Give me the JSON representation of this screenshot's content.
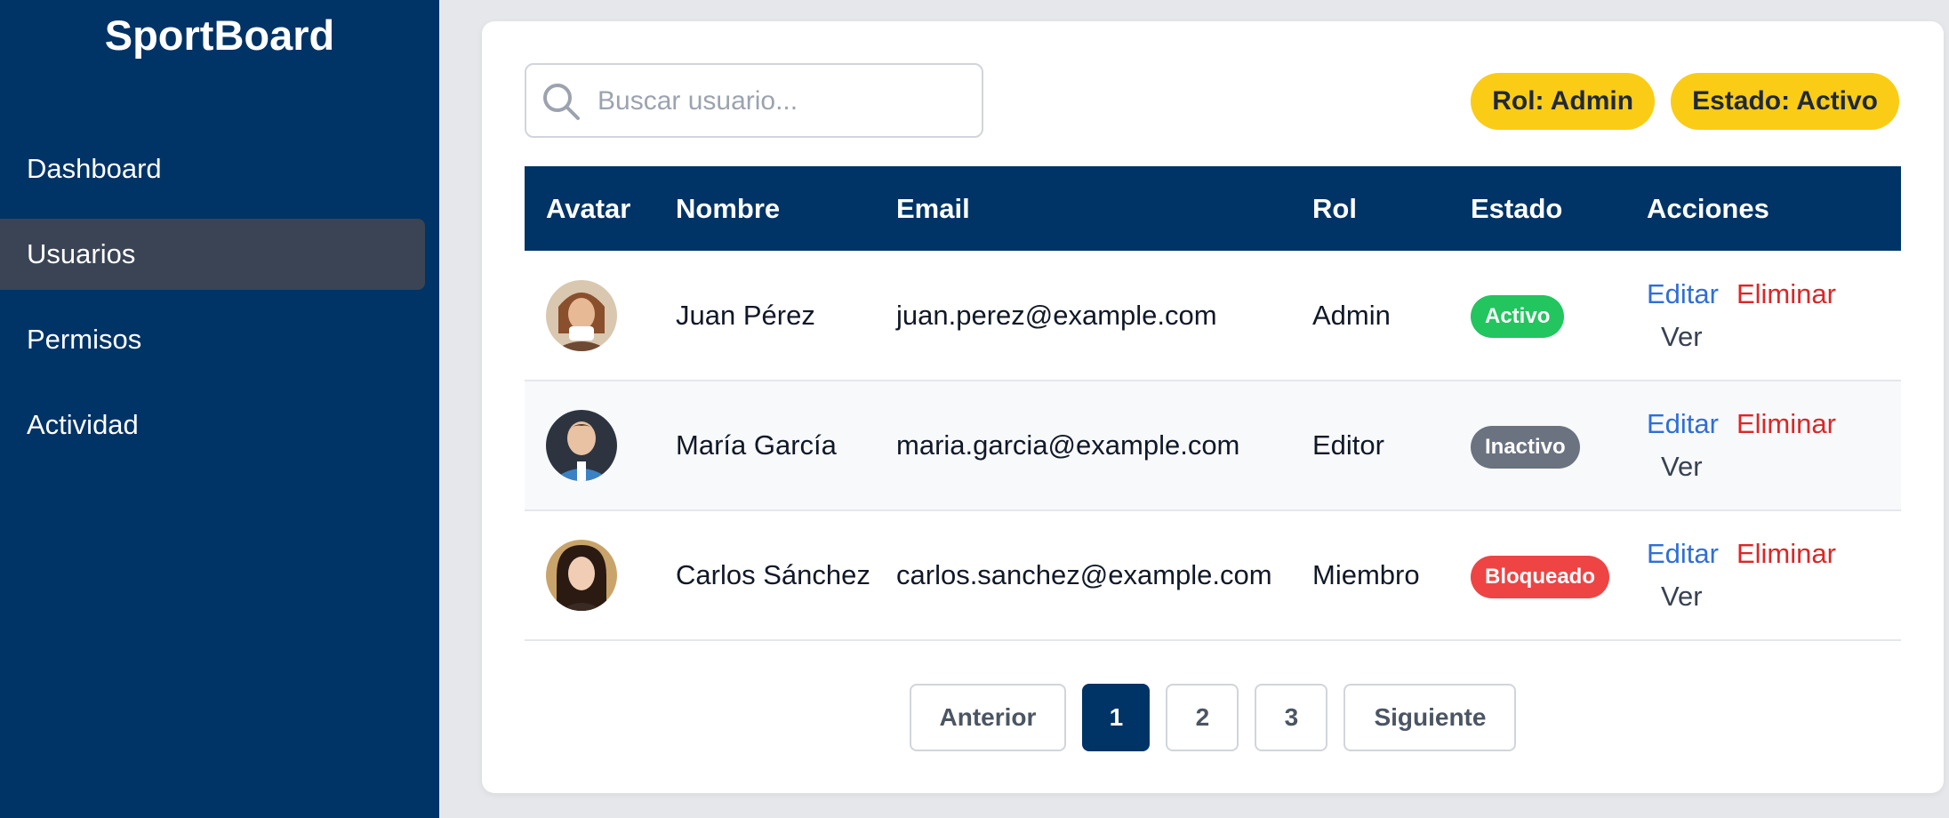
{
  "sidebar": {
    "brand": "SportBoard",
    "items": [
      {
        "label": "Dashboard"
      },
      {
        "label": "Usuarios"
      },
      {
        "label": "Permisos"
      },
      {
        "label": "Actividad"
      }
    ],
    "active_item": "Usuarios"
  },
  "toolbar": {
    "search": {
      "placeholder": "Buscar usuario...",
      "value": ""
    },
    "filters": [
      "Rol: Admin",
      "Estado: Activo"
    ]
  },
  "table": {
    "columns": [
      "Avatar",
      "Nombre",
      "Email",
      "Rol",
      "Estado",
      "Acciones"
    ],
    "rows": [
      {
        "name": "Juan Pérez",
        "email": "juan.perez@example.com",
        "role": "Admin",
        "status": "Activo",
        "status_color": "#22c55e"
      },
      {
        "name": "María García",
        "email": "maria.garcia@example.com",
        "role": "Editor",
        "status": "Inactivo",
        "status_color": "#6b7280"
      },
      {
        "name": "Carlos Sánchez",
        "email": "carlos.sanchez@example.com",
        "role": "Miembro",
        "status": "Bloqueado",
        "status_color": "#ef4444"
      }
    ],
    "actions": {
      "edit": "Editar",
      "delete": "Eliminar",
      "view": "Ver"
    }
  },
  "pagination": {
    "prev": "Anterior",
    "pages": [
      "1",
      "2",
      "3"
    ],
    "current": "1",
    "next": "Siguiente"
  },
  "colors": {
    "primary": "#003366",
    "accent": "#facc15",
    "active_badge": "#22c55e",
    "inactive_badge": "#6b7280",
    "blocked_badge": "#ef4444",
    "edit_link": "#2f6fd6",
    "delete_link": "#dc2626"
  }
}
